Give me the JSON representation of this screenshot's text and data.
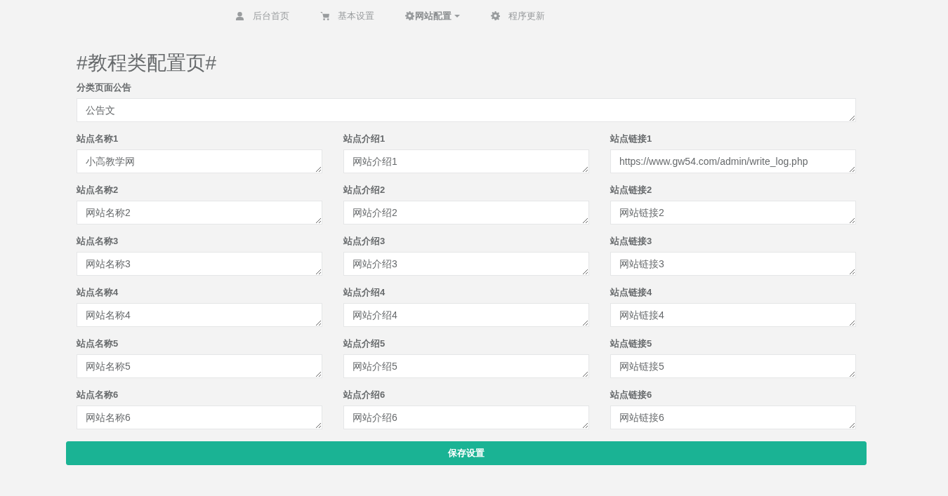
{
  "nav": [
    {
      "label": "后台首页",
      "kind": "link"
    },
    {
      "label": "基本设置",
      "kind": "link"
    },
    {
      "label": "网站配置",
      "kind": "dropdown"
    },
    {
      "label": "程序更新",
      "kind": "link"
    }
  ],
  "title": "#教程类配置页#",
  "announcement": {
    "label": "分类页面公告",
    "value": "公告文"
  },
  "fields": [
    {
      "label": "站点名称1",
      "value": "小高教学网"
    },
    {
      "label": "站点介绍1",
      "value": "网站介绍1"
    },
    {
      "label": "站点链接1",
      "value": "https://www.gw54.com/admin/write_log.php"
    },
    {
      "label": "站点名称2",
      "value": "网站名称2"
    },
    {
      "label": "站点介绍2",
      "value": "网站介绍2"
    },
    {
      "label": "站点链接2",
      "value": "网站链接2"
    },
    {
      "label": "站点名称3",
      "value": "网站名称3"
    },
    {
      "label": "站点介绍3",
      "value": "网站介绍3"
    },
    {
      "label": "站点链接3",
      "value": "网站链接3"
    },
    {
      "label": "站点名称4",
      "value": "网站名称4"
    },
    {
      "label": "站点介绍4",
      "value": "网站介绍4"
    },
    {
      "label": "站点链接4",
      "value": "网站链接4"
    },
    {
      "label": "站点名称5",
      "value": "网站名称5"
    },
    {
      "label": "站点介绍5",
      "value": "网站介绍5"
    },
    {
      "label": "站点链接5",
      "value": "网站链接5"
    },
    {
      "label": "站点名称6",
      "value": "网站名称6"
    },
    {
      "label": "站点介绍6",
      "value": "网站介绍6"
    },
    {
      "label": "站点链接6",
      "value": "网站链接6"
    }
  ],
  "save_button": "保存设置"
}
